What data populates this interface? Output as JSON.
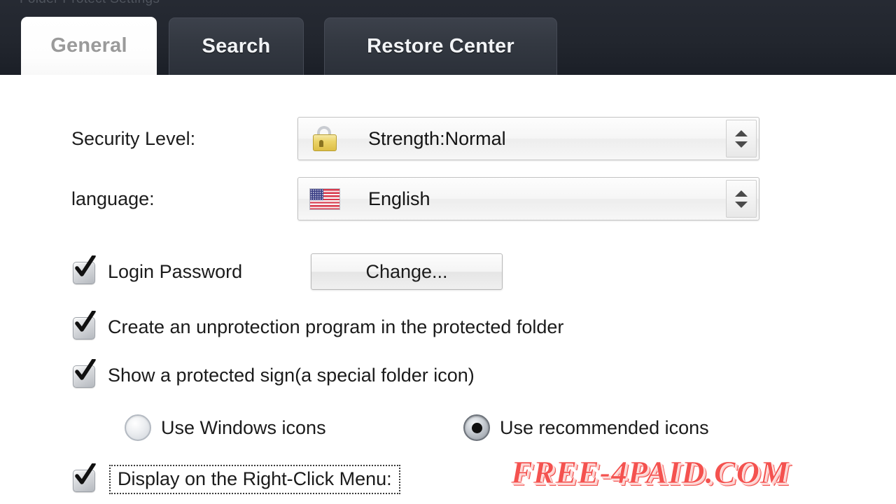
{
  "window": {
    "clipped_title": "Folder Protect  Settings"
  },
  "tabs": [
    {
      "id": "general",
      "label": "General",
      "active": true
    },
    {
      "id": "search",
      "label": "Search",
      "active": false
    },
    {
      "id": "restore",
      "label": "Restore Center",
      "active": false
    }
  ],
  "general": {
    "security_level": {
      "label": "Security Level:",
      "icon": "padlock-icon",
      "value": "Strength:Normal"
    },
    "language": {
      "label": "language:",
      "icon": "us-flag-icon",
      "value": "English"
    },
    "login_password": {
      "label": "Login Password",
      "checked": true,
      "button_label": "Change..."
    },
    "create_unprotection_program": {
      "label": "Create an unprotection program in the protected folder",
      "checked": true
    },
    "show_protected_sign": {
      "label": "Show a protected sign(a special folder icon)",
      "checked": true
    },
    "icon_style": {
      "options": [
        {
          "id": "windows-icons",
          "label": "Use Windows icons",
          "selected": false
        },
        {
          "id": "recommended-icons",
          "label": "Use recommended icons",
          "selected": true
        }
      ]
    },
    "right_click_menu": {
      "label": "Display on the Right-Click Menu:",
      "checked": true,
      "focused": true
    }
  },
  "watermark": {
    "text": "FREE-4PAID.COM",
    "color": "#f4524f"
  },
  "colors": {
    "tabbar_bg": "#23272f",
    "tab_inactive_bg": "#383d47",
    "tab_active_bg": "#fbfbfb",
    "content_bg": "#ffffff",
    "text": "#1b1b1b"
  }
}
